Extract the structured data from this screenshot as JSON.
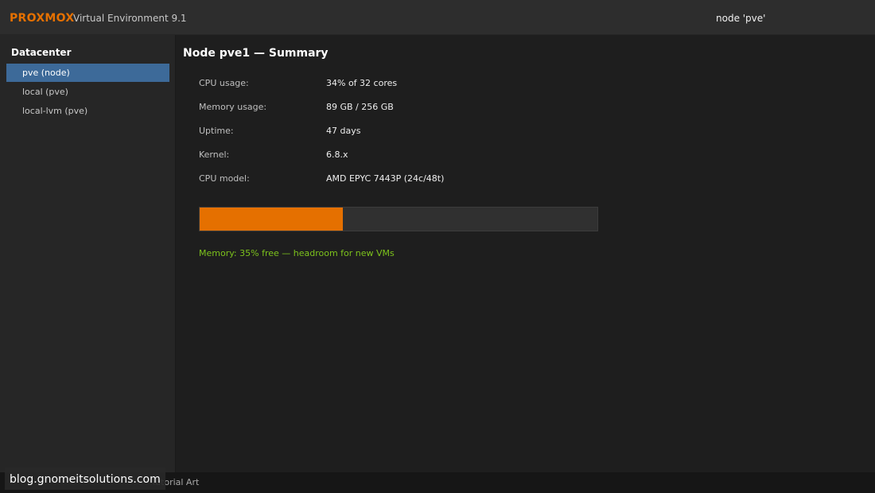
{
  "header": {
    "brand": "PROXMOX",
    "product": "Virtual Environment 9.1",
    "node_label": "node 'pve'"
  },
  "sidebar": {
    "title": "Datacenter",
    "items": [
      {
        "label": "pve (node)",
        "selected": true
      },
      {
        "label": "local (pve)",
        "selected": false
      },
      {
        "label": "local-lvm (pve)",
        "selected": false
      }
    ]
  },
  "main": {
    "title": "Node pve1 — Summary",
    "rows": [
      {
        "label": "CPU usage:",
        "value": "34% of 32 cores"
      },
      {
        "label": "Memory usage:",
        "value": "89 GB / 256 GB"
      },
      {
        "label": "Uptime:",
        "value": "47 days"
      },
      {
        "label": "Kernel:",
        "value": "6.8.x"
      },
      {
        "label": "CPU model:",
        "value": "AMD EPYC 7443P (24c/48t)"
      }
    ],
    "progress_fraction": 0.36,
    "status_text": "Memory: 35% free — headroom for new VMs"
  },
  "footer": {
    "text": "Tutorial Art"
  },
  "watermark": {
    "text": "blog.gnomeitsolutions.com"
  },
  "colors": {
    "brand": "#e57000",
    "selection": "#3d6a99",
    "progress": "#e57000",
    "status": "#7cc21c"
  }
}
